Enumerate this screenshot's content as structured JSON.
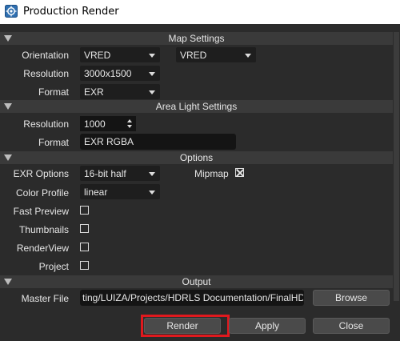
{
  "window": {
    "title": "Production Render",
    "app_icon": "vred-render-icon"
  },
  "sections": {
    "map_settings": "Map Settings",
    "area_light_settings": "Area Light Settings",
    "options": "Options",
    "output": "Output"
  },
  "map_settings": {
    "orientation_label": "Orientation",
    "orientation_value": "VRED",
    "orientation_value_2": "VRED",
    "resolution_label": "Resolution",
    "resolution_value": "3000x1500",
    "format_label": "Format",
    "format_value": "EXR"
  },
  "area_light_settings": {
    "resolution_label": "Resolution",
    "resolution_value": "1000",
    "format_label": "Format",
    "format_value": "EXR RGBA"
  },
  "options": {
    "exr_options_label": "EXR Options",
    "exr_options_value": "16-bit half",
    "mipmap_label": "Mipmap",
    "mipmap_checked": true,
    "color_profile_label": "Color Profile",
    "color_profile_value": "linear",
    "fast_preview_label": "Fast Preview",
    "fast_preview_checked": false,
    "thumbnails_label": "Thumbnails",
    "thumbnails_checked": false,
    "renderview_label": "RenderView",
    "renderview_checked": false,
    "project_label": "Project",
    "project_checked": false
  },
  "output": {
    "master_file_label": "Master File",
    "master_file_value": "ting/LUIZA/Projects/HDRLS Documentation/FinalHDRI.exr",
    "browse_label": "Browse"
  },
  "actions": {
    "render_label": "Render",
    "apply_label": "Apply",
    "close_label": "Close"
  },
  "colors": {
    "background": "#2b2b2b",
    "section_header": "#3a3a3a",
    "field": "#1e1e1e",
    "highlight": "#e0191e"
  }
}
